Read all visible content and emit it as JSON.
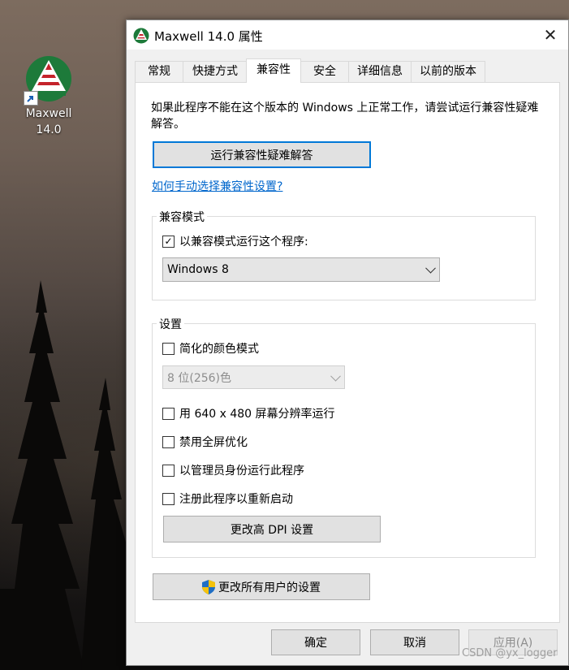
{
  "desktop": {
    "shortcut_label_line1": "Maxwell",
    "shortcut_label_line2": "14.0"
  },
  "window": {
    "title": "Maxwell 14.0 属性",
    "close_glyph": "✕"
  },
  "tabs": [
    {
      "label": "常规"
    },
    {
      "label": "快捷方式"
    },
    {
      "label": "兼容性",
      "active": true
    },
    {
      "label": "安全"
    },
    {
      "label": "详细信息"
    },
    {
      "label": "以前的版本"
    }
  ],
  "compat": {
    "description": "如果此程序不能在这个版本的 Windows 上正常工作，请尝试运行兼容性疑难解答。",
    "troubleshoot_button": "运行兼容性疑难解答",
    "manual_link": "如何手动选择兼容性设置?",
    "mode_group": {
      "label": "兼容模式",
      "checkbox_label": "以兼容模式运行这个程序:",
      "checked": true,
      "selected_os": "Windows 8"
    },
    "settings_group": {
      "label": "设置",
      "reduced_color_label": "简化的颜色模式",
      "color_select_value": "8 位(256)色",
      "res_640_label": "用 640 x 480 屏幕分辨率运行",
      "disable_fullscreen_label": "禁用全屏优化",
      "run_as_admin_label": "以管理员身份运行此程序",
      "register_restart_label": "注册此程序以重新启动",
      "dpi_button": "更改高 DPI 设置"
    },
    "all_users_button": "更改所有用户的设置"
  },
  "footer": {
    "ok": "确定",
    "cancel": "取消",
    "apply": "应用(A)"
  },
  "watermark": "CSDN @yx_logger",
  "colors": {
    "accent": "#0078d7",
    "link": "#0066cc"
  }
}
